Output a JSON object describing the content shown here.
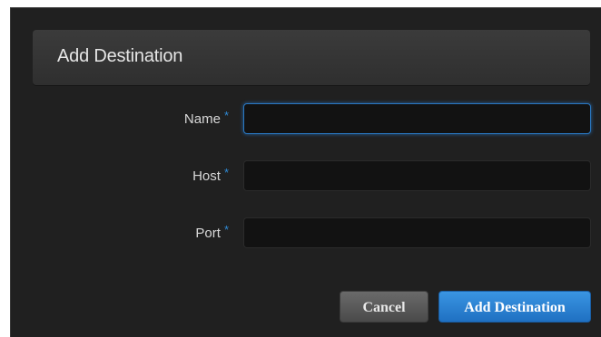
{
  "dialog": {
    "title": "Add Destination"
  },
  "form": {
    "fields": [
      {
        "label": "Name",
        "required_mark": "*",
        "value": ""
      },
      {
        "label": "Host",
        "required_mark": "*",
        "value": ""
      },
      {
        "label": "Port",
        "required_mark": "*",
        "value": ""
      }
    ]
  },
  "buttons": {
    "cancel_label": "Cancel",
    "submit_label": "Add Destination"
  },
  "colors": {
    "background": "#202020",
    "accent": "#2f8bd6",
    "primary_button": "#2a82d4"
  }
}
